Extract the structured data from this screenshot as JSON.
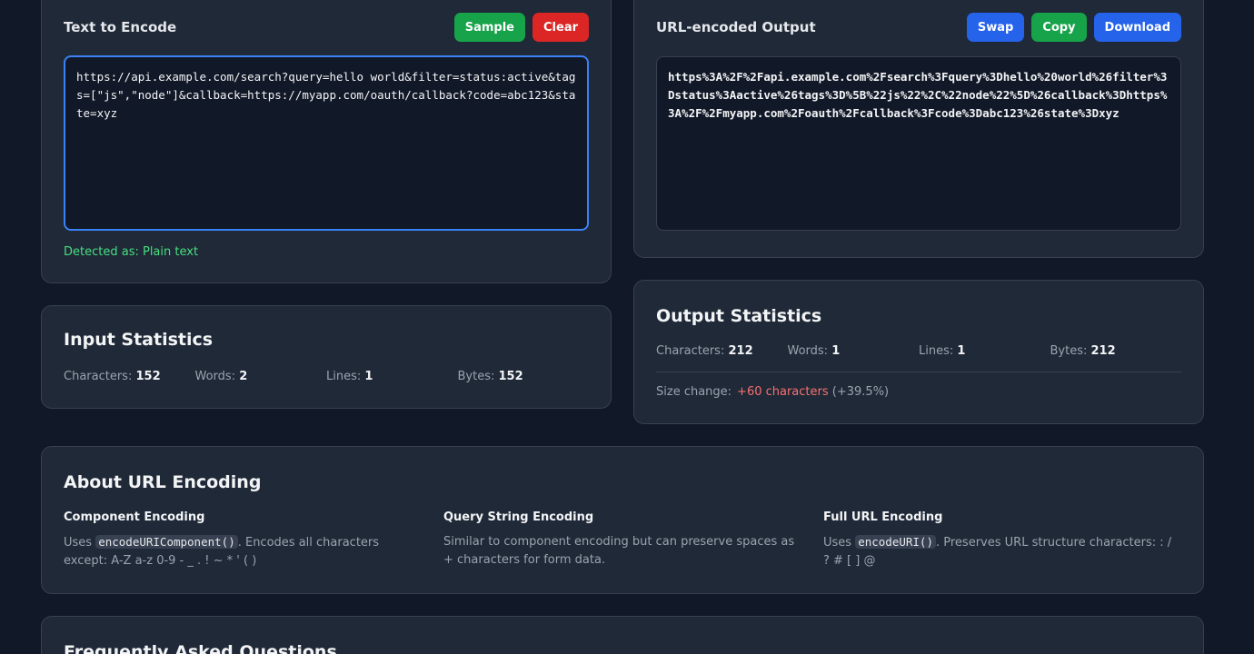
{
  "input_panel": {
    "title": "Text to Encode",
    "sample_label": "Sample",
    "clear_label": "Clear",
    "value": "https://api.example.com/search?query=hello world&filter=status:active&tags=[\"js\",\"node\"]&callback=https://myapp.com/oauth/callback?code=abc123&state=xyz",
    "detected": "Detected as: Plain text"
  },
  "output_panel": {
    "title": "URL-encoded Output",
    "swap_label": "Swap",
    "copy_label": "Copy",
    "download_label": "Download",
    "value": "https%3A%2F%2Fapi.example.com%2Fsearch%3Fquery%3Dhello%20world%26filter%3Dstatus%3Aactive%26tags%3D%5B%22js%22%2C%22node%22%5D%26callback%3Dhttps%3A%2F%2Fmyapp.com%2Foauth%2Fcallback%3Fcode%3Dabc123%26state%3Dxyz"
  },
  "input_stats": {
    "title": "Input Statistics",
    "characters_label": "Characters:",
    "characters": "152",
    "words_label": "Words:",
    "words": "2",
    "lines_label": "Lines:",
    "lines": "1",
    "bytes_label": "Bytes:",
    "bytes": "152"
  },
  "output_stats": {
    "title": "Output Statistics",
    "characters_label": "Characters:",
    "characters": "212",
    "words_label": "Words:",
    "words": "1",
    "lines_label": "Lines:",
    "lines": "1",
    "bytes_label": "Bytes:",
    "bytes": "212",
    "size_change_label": "Size change:",
    "size_change_value": "+60 characters",
    "size_change_pct": "(+39.5%)"
  },
  "about": {
    "title": "About URL Encoding",
    "component": {
      "heading": "Component Encoding",
      "pre": "Uses ",
      "code": "encodeURIComponent()",
      "post": ". Encodes all characters except: A-Z a-z 0-9 - _ . ! ~ * ' ( )"
    },
    "query": {
      "heading": "Query String Encoding",
      "text": "Similar to component encoding but can preserve spaces as + characters for form data."
    },
    "full": {
      "heading": "Full URL Encoding",
      "pre": "Uses ",
      "code": "encodeURI()",
      "post": ". Preserves URL structure characters: : / ? # [ ] @"
    }
  },
  "faq": {
    "title": "Frequently Asked Questions"
  },
  "colors": {
    "background": "#111827",
    "card": "#1f2937",
    "green": "#16a34a",
    "red": "#dc2626",
    "blue": "#2563eb",
    "detected": "#4ade80",
    "size_increase": "#f87171"
  }
}
